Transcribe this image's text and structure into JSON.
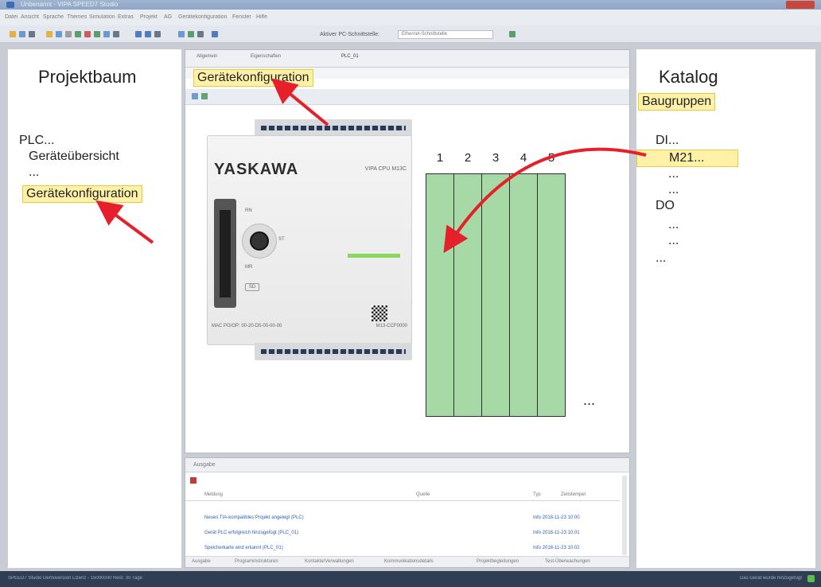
{
  "window": {
    "title": "Unbenannt - VIPA SPEED7 Studio",
    "menu": [
      "Datei",
      "Ansicht",
      "Sprache",
      "Themes",
      "Simulation",
      "Extras",
      "Projekt",
      "AG",
      "Gerätekonfiguration",
      "Fenster",
      "Hilfe"
    ],
    "toolbar_label": "Aktiver PC-Schnittstelle:",
    "toolbar_select": "Ethernet-Schnittstelle"
  },
  "left": {
    "title": "Projektbaum",
    "items": [
      "PLC...",
      "Geräteübersicht",
      "..."
    ],
    "highlight": "Gerätekonfiguration"
  },
  "center": {
    "tabs": [
      "Allgemein",
      "Eigenschaften",
      "PLC_01"
    ],
    "title": "Gerätekonfiguration",
    "cpu": {
      "brand": "YASKAWA",
      "model": "VIPA CPU M13C",
      "rn": "RN",
      "st": "ST",
      "mr": "MR",
      "sd": "SD",
      "mac": "MAC PG/OP: 00-20-D5-00-00-00",
      "part": "M13-CCF0000"
    },
    "slots": [
      "1",
      "2",
      "3",
      "4",
      "5"
    ],
    "more": "..."
  },
  "right": {
    "title": "Katalog",
    "highlight": "Baugruppen",
    "items": [
      "DI...",
      "...",
      "...",
      "DO",
      "...",
      "...",
      "..."
    ],
    "selected": "M21..."
  },
  "output": {
    "title": "Ausgabe",
    "columns": [
      "Meldung",
      "Quelle",
      "Typ",
      "Zeitstempel"
    ],
    "rows": [
      {
        "text": "Neues TIA-kompatibles Projekt angelegt (PLC)",
        "meta": "Info  2018-11-23 10:00"
      },
      {
        "text": "Gerät PLC erfolgreich hinzugefügt (PLC_01)",
        "meta": "Info  2018-11-23 10:01"
      },
      {
        "text": "Speicherkarte wird erkannt (PLC_01)",
        "meta": "Info  2018-11-23 10:02"
      }
    ],
    "tabs": [
      "Ausgabe",
      "Programmstrukturen",
      "Kontakte/Verwaltungen",
      "Kommunikationsdetails",
      "Projektbegleitungen",
      "Test-Überwachungen"
    ]
  },
  "status": {
    "left": "SPEED7 Studio Demoversion Lizenz - 15000000 Rest: 30 Tage",
    "right": "Das Gerät wurde hinzugefügt"
  },
  "colors": {
    "highlight": "#fff2a8",
    "slot": "#a7d9a6",
    "arrow": "#e5202a"
  }
}
